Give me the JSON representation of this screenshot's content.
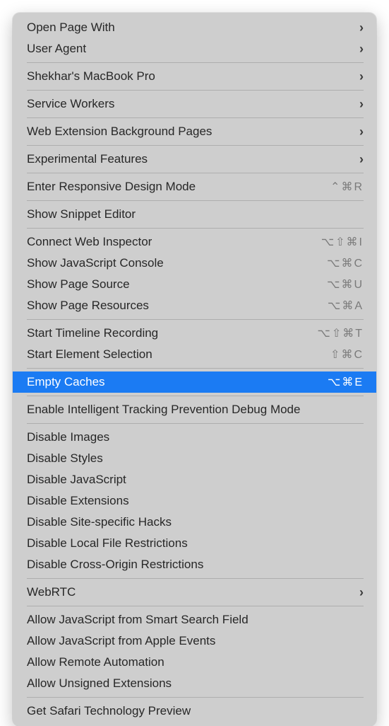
{
  "menu": {
    "sections": [
      [
        {
          "id": "open-page-with",
          "label": "Open Page With",
          "submenu": true
        },
        {
          "id": "user-agent",
          "label": "User Agent",
          "submenu": true
        }
      ],
      [
        {
          "id": "device-name",
          "label": "Shekhar's MacBook Pro",
          "submenu": true
        }
      ],
      [
        {
          "id": "service-workers",
          "label": "Service Workers",
          "submenu": true
        }
      ],
      [
        {
          "id": "web-extension-bg-pages",
          "label": "Web Extension Background Pages",
          "submenu": true
        }
      ],
      [
        {
          "id": "experimental-features",
          "label": "Experimental Features",
          "submenu": true
        }
      ],
      [
        {
          "id": "enter-responsive-design-mode",
          "label": "Enter Responsive Design Mode",
          "shortcut": "⌃⌘R"
        }
      ],
      [
        {
          "id": "show-snippet-editor",
          "label": "Show Snippet Editor"
        }
      ],
      [
        {
          "id": "connect-web-inspector",
          "label": "Connect Web Inspector",
          "shortcut": "⌥⇧⌘I"
        },
        {
          "id": "show-js-console",
          "label": "Show JavaScript Console",
          "shortcut": "⌥⌘C"
        },
        {
          "id": "show-page-source",
          "label": "Show Page Source",
          "shortcut": "⌥⌘U"
        },
        {
          "id": "show-page-resources",
          "label": "Show Page Resources",
          "shortcut": "⌥⌘A"
        }
      ],
      [
        {
          "id": "start-timeline-recording",
          "label": "Start Timeline Recording",
          "shortcut": "⌥⇧⌘T"
        },
        {
          "id": "start-element-selection",
          "label": "Start Element Selection",
          "shortcut": "⇧⌘C"
        }
      ],
      [
        {
          "id": "empty-caches",
          "label": "Empty Caches",
          "shortcut": "⌥⌘E",
          "highlighted": true
        }
      ],
      [
        {
          "id": "enable-itp-debug",
          "label": "Enable Intelligent Tracking Prevention Debug Mode"
        }
      ],
      [
        {
          "id": "disable-images",
          "label": "Disable Images"
        },
        {
          "id": "disable-styles",
          "label": "Disable Styles"
        },
        {
          "id": "disable-javascript",
          "label": "Disable JavaScript"
        },
        {
          "id": "disable-extensions",
          "label": "Disable Extensions"
        },
        {
          "id": "disable-site-specific-hacks",
          "label": "Disable Site-specific Hacks"
        },
        {
          "id": "disable-local-file-restrictions",
          "label": "Disable Local File Restrictions"
        },
        {
          "id": "disable-cors",
          "label": "Disable Cross-Origin Restrictions"
        }
      ],
      [
        {
          "id": "webrtc",
          "label": "WebRTC",
          "submenu": true
        }
      ],
      [
        {
          "id": "allow-js-smart-search",
          "label": "Allow JavaScript from Smart Search Field"
        },
        {
          "id": "allow-js-apple-events",
          "label": "Allow JavaScript from Apple Events"
        },
        {
          "id": "allow-remote-automation",
          "label": "Allow Remote Automation"
        },
        {
          "id": "allow-unsigned-extensions",
          "label": "Allow Unsigned Extensions"
        }
      ],
      [
        {
          "id": "get-safari-tech-preview",
          "label": "Get Safari Technology Preview"
        }
      ]
    ]
  }
}
